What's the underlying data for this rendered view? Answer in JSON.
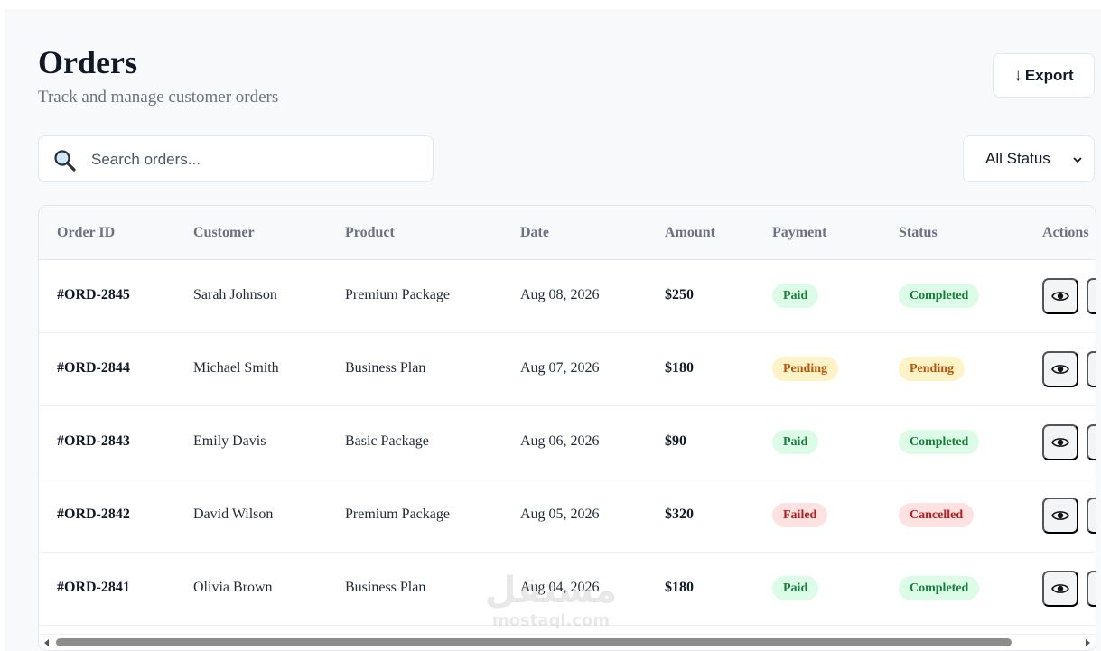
{
  "header": {
    "title": "Orders",
    "subtitle": "Track and manage customer orders",
    "export_arrow": "↓",
    "export_label": "Export"
  },
  "search": {
    "placeholder": "Search orders...",
    "value": "",
    "icon": "search-icon"
  },
  "filter": {
    "selected": "All Status",
    "options": [
      "All Status"
    ]
  },
  "table": {
    "columns": [
      "Order ID",
      "Customer",
      "Product",
      "Date",
      "Amount",
      "Payment",
      "Status",
      "Actions"
    ],
    "rows": [
      {
        "id": "#ORD-2845",
        "customer": "Sarah Johnson",
        "product": "Premium Package",
        "date": "Aug 08, 2026",
        "amount": "$250",
        "payment": "Paid",
        "status": "Completed"
      },
      {
        "id": "#ORD-2844",
        "customer": "Michael Smith",
        "product": "Business Plan",
        "date": "Aug 07, 2026",
        "amount": "$180",
        "payment": "Pending",
        "status": "Pending"
      },
      {
        "id": "#ORD-2843",
        "customer": "Emily Davis",
        "product": "Basic Package",
        "date": "Aug 06, 2026",
        "amount": "$90",
        "payment": "Paid",
        "status": "Completed"
      },
      {
        "id": "#ORD-2842",
        "customer": "David Wilson",
        "product": "Premium Package",
        "date": "Aug 05, 2026",
        "amount": "$320",
        "payment": "Failed",
        "status": "Cancelled"
      },
      {
        "id": "#ORD-2841",
        "customer": "Olivia Brown",
        "product": "Business Plan",
        "date": "Aug 04, 2026",
        "amount": "$180",
        "payment": "Paid",
        "status": "Completed"
      }
    ]
  },
  "watermark": {
    "arabic": "مستقل",
    "latin": "mostaql.com"
  },
  "colors": {
    "paid": "#15803d",
    "pending": "#b45309",
    "failed": "#b91c1c",
    "background": "#f8f9fb"
  }
}
